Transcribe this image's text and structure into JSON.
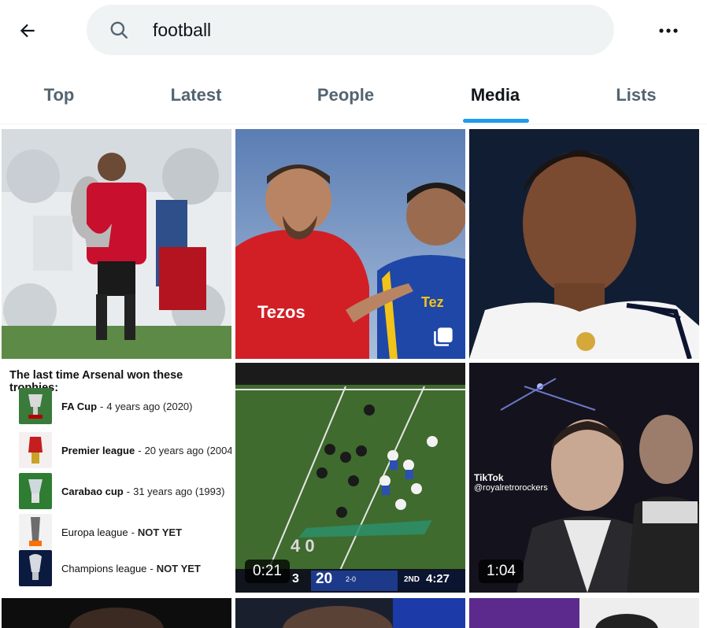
{
  "search": {
    "query": "football",
    "placeholder": "Search"
  },
  "tabs": [
    {
      "label": "Top",
      "active": false
    },
    {
      "label": "Latest",
      "active": false
    },
    {
      "label": "People",
      "active": false
    },
    {
      "label": "Media",
      "active": true
    },
    {
      "label": "Lists",
      "active": false
    }
  ],
  "colors": {
    "accent": "#1d9bf0",
    "search_bg": "#eff3f4",
    "text": "#0f1419",
    "muted": "#536471"
  },
  "icons": {
    "back": "arrow-left-icon",
    "search": "search-icon",
    "more": "more-dots-icon",
    "multi": "multiple-images-icon"
  },
  "media": [
    {
      "kind": "image"
    },
    {
      "kind": "image",
      "multi": true
    },
    {
      "kind": "image"
    },
    {
      "kind": "image",
      "title": "The last time Arsenal won these trophies:",
      "rows": [
        {
          "name": "FA Cup",
          "sep": " -",
          "detail": "4 years ago (2020)",
          "bold_detail": false
        },
        {
          "name": "Premier league",
          "sep": " -",
          "detail": "20 years ago (2004)",
          "bold_detail": false
        },
        {
          "name": "Carabao cup",
          "sep": " -",
          "detail": "31 years ago (1993)",
          "bold_detail": false
        },
        {
          "name": "Europa league",
          "sep": " -",
          "detail": "NOT YET",
          "bold_detail": true
        },
        {
          "name": "Champions league",
          "sep": " -",
          "detail": "NOT YET",
          "bold_detail": true
        }
      ]
    },
    {
      "kind": "video",
      "duration": "0:21",
      "scoreboard": {
        "score_left": "3",
        "score_right": "20",
        "record": "2-0",
        "quarter": "2ND",
        "clock": "4:27"
      }
    },
    {
      "kind": "video",
      "duration": "1:04",
      "watermark": {
        "brand": "TikTok",
        "handle": "@royalretrorockers"
      }
    }
  ]
}
